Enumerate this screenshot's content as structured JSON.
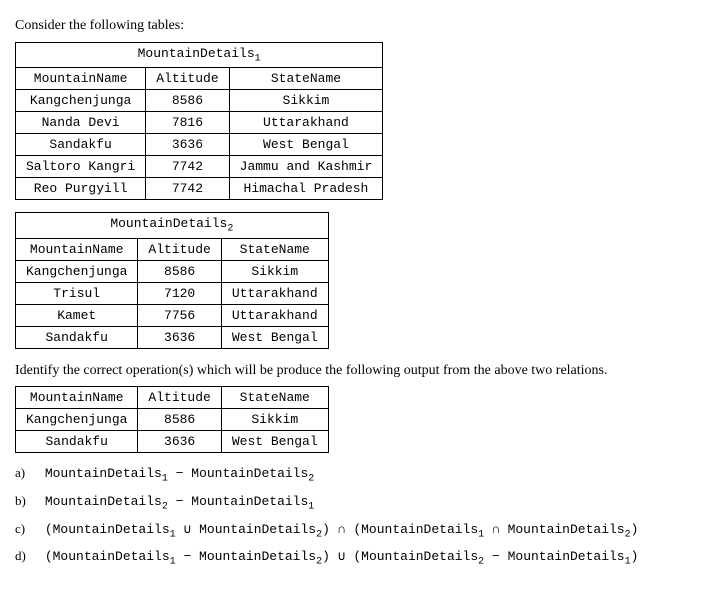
{
  "intro": "Consider the following tables:",
  "table1": {
    "title": "MountainDetails",
    "sub": "1",
    "headers": [
      "MountainName",
      "Altitude",
      "StateName"
    ],
    "rows": [
      [
        "Kangchenjunga",
        "8586",
        "Sikkim"
      ],
      [
        "Nanda Devi",
        "7816",
        "Uttarakhand"
      ],
      [
        "Sandakfu",
        "3636",
        "West Bengal"
      ],
      [
        "Saltoro Kangri",
        "7742",
        "Jammu and Kashmir"
      ],
      [
        "Reo Purgyill",
        "7742",
        "Himachal Pradesh"
      ]
    ]
  },
  "table2": {
    "title": "MountainDetails",
    "sub": "2",
    "headers": [
      "MountainName",
      "Altitude",
      "StateName"
    ],
    "rows": [
      [
        "Kangchenjunga",
        "8586",
        "Sikkim"
      ],
      [
        "Trisul",
        "7120",
        "Uttarakhand"
      ],
      [
        "Kamet",
        "7756",
        "Uttarakhand"
      ],
      [
        "Sandakfu",
        "3636",
        "West Bengal"
      ]
    ]
  },
  "question": "Identify the correct operation(s) which will be produce the following output from the above two relations.",
  "table3": {
    "headers": [
      "MountainName",
      "Altitude",
      "StateName"
    ],
    "rows": [
      [
        "Kangchenjunga",
        "8586",
        "Sikkim"
      ],
      [
        "Sandakfu",
        "3636",
        "West Bengal"
      ]
    ]
  },
  "options": {
    "a": {
      "label": "a)",
      "parts": [
        "MountainDetails",
        "1",
        " − MountainDetails",
        "2"
      ]
    },
    "b": {
      "label": "b)",
      "parts": [
        "MountainDetails",
        "2",
        " − MountainDetails",
        "1"
      ]
    },
    "c": {
      "label": "c)",
      "parts": [
        "(MountainDetails",
        "1",
        " ∪ MountainDetails",
        "2",
        ") ∩ (MountainDetails",
        "1",
        " ∩ MountainDetails",
        "2",
        ")"
      ]
    },
    "d": {
      "label": "d)",
      "parts": [
        "(MountainDetails",
        "1",
        " − MountainDetails",
        "2",
        ") ∪ (MountainDetails",
        "2",
        " − MountainDetails",
        "1",
        ")"
      ]
    }
  }
}
